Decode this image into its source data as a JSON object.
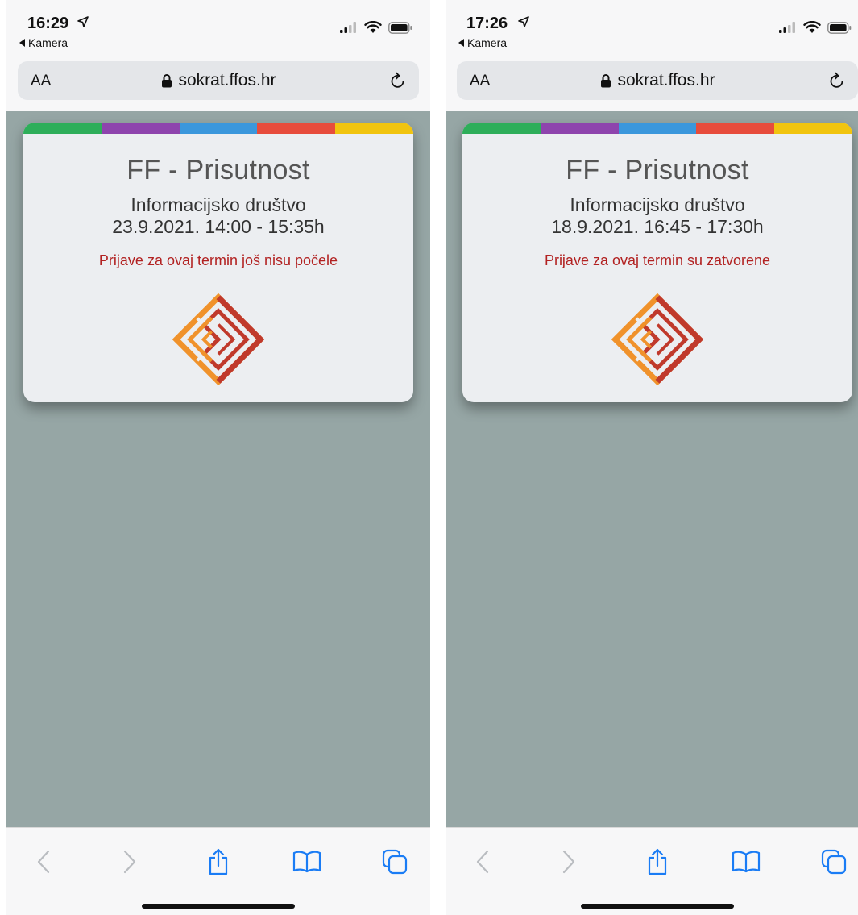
{
  "colors": {
    "stripe": [
      "#2eae5a",
      "#8e44ad",
      "#3b97dc",
      "#e74c3c",
      "#f1c40f"
    ],
    "page_bg": "#96a6a5",
    "status_red": "#b22222",
    "tool_blue": "#1a7cf5"
  },
  "screens": [
    {
      "status": {
        "time": "16:29",
        "back_label": "Kamera"
      },
      "browser": {
        "aa": "AA",
        "url": "sokrat.ffos.hr"
      },
      "card": {
        "title": "FF - Prisutnost",
        "subject": "Informacijsko društvo",
        "datetime": "23.9.2021. 14:00 - 15:35h",
        "status": "Prijave za ovaj termin još nisu počele"
      }
    },
    {
      "status": {
        "time": "17:26",
        "back_label": "Kamera"
      },
      "browser": {
        "aa": "AA",
        "url": "sokrat.ffos.hr"
      },
      "card": {
        "title": "FF - Prisutnost",
        "subject": "Informacijsko društvo",
        "datetime": "18.9.2021. 16:45 - 17:30h",
        "status": "Prijave za ovaj termin su zatvorene"
      }
    }
  ],
  "icons": {
    "location": "location-arrow-icon",
    "signal": "cellular-signal-icon",
    "wifi": "wifi-icon",
    "battery": "battery-icon",
    "lock": "lock-icon",
    "reload": "reload-icon",
    "back": "back-chevron-icon",
    "forward": "forward-chevron-icon",
    "share": "share-icon",
    "bookmarks": "bookmarks-book-icon",
    "tabs": "tabs-icon"
  }
}
